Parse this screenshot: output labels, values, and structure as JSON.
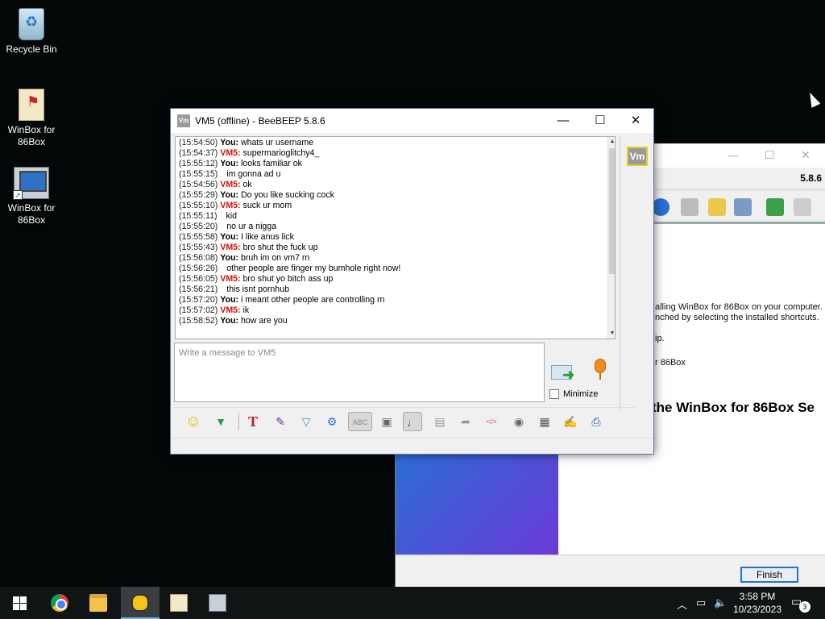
{
  "desktop": {
    "icons": [
      {
        "label": "Recycle Bin",
        "icon": "recycle-bin-icon"
      },
      {
        "label": "WinBox for 86Box",
        "icon": "winbox-document-icon"
      },
      {
        "label": "WinBox for 86Box",
        "icon": "winbox-computer-icon"
      }
    ]
  },
  "installer": {
    "version": "5.8.6",
    "heading": "the WinBox for 86Box Se",
    "line1": "alling WinBox for 86Box on your computer. T",
    "line2": "nched by selecting the installed shortcuts.",
    "line3": "ip.",
    "line4": "r 86Box",
    "finish_label": "Finish"
  },
  "chat": {
    "title": "VM5 (offline) - BeeBEEP 5.8.6",
    "app_icon_text": "Vm",
    "peer_badge": "Vm",
    "compose_placeholder": "Write a message to VM5",
    "minimize_label": "Minimize",
    "minimize_checked": false,
    "messages": [
      {
        "time": "(15:54:50)",
        "sender": "You:",
        "type": "me",
        "text": "whats ur username"
      },
      {
        "time": "(15:54:37)",
        "sender": "VM5:",
        "type": "vm",
        "text": "supermarioglitchy4_"
      },
      {
        "time": "(15:55:12)",
        "sender": "You:",
        "type": "me",
        "text": "looks familiar ok"
      },
      {
        "time": "(15:55:15)",
        "sender": "",
        "type": "cont",
        "text": "im gonna ad u"
      },
      {
        "time": "(15:54:56)",
        "sender": "VM5:",
        "type": "vm",
        "text": "ok"
      },
      {
        "time": "(15:55:29)",
        "sender": "You:",
        "type": "me",
        "text": "Do you like sucking cock"
      },
      {
        "time": "(15:55:10)",
        "sender": "VM5:",
        "type": "vm",
        "text": "suck ur mom"
      },
      {
        "time": "(15:55:11)",
        "sender": "",
        "type": "cont",
        "text": "kid"
      },
      {
        "time": "(15:55:20)",
        "sender": "",
        "type": "cont",
        "text": "no ur a nigga"
      },
      {
        "time": "(15:55:58)",
        "sender": "You:",
        "type": "me",
        "text": "I like anus lick"
      },
      {
        "time": "(15:55:43)",
        "sender": "VM5:",
        "type": "vm",
        "text": "bro shut the fuck up"
      },
      {
        "time": "(15:56:08)",
        "sender": "You:",
        "type": "me",
        "text": "bruh im on vm7 rn"
      },
      {
        "time": "(15:56:26)",
        "sender": "",
        "type": "cont",
        "text": "other people are finger my bumhole right now!"
      },
      {
        "time": "(15:56:05)",
        "sender": "VM5:",
        "type": "vm",
        "text": "bro shut yo bitch ass up"
      },
      {
        "time": "(15:56:21)",
        "sender": "",
        "type": "cont",
        "text": "this isnt pornhub"
      },
      {
        "time": "(15:57:20)",
        "sender": "You:",
        "type": "me",
        "text": "i meant other people are controlling rn"
      },
      {
        "time": "(15:57:02)",
        "sender": "VM5:",
        "type": "vm",
        "text": "ik"
      },
      {
        "time": "(15:58:52)",
        "sender": "You:",
        "type": "me",
        "text": "how are you"
      }
    ],
    "toolbar": [
      "emoticons-icon",
      "file-send-icon",
      "font-icon",
      "color-icon",
      "filter-icon",
      "settings-icon",
      "spellcheck-icon",
      "autocomplete-icon",
      "note-icon",
      "save-icon",
      "forward-icon",
      "html-icon",
      "screenshot-icon",
      "archive-icon",
      "edit-icon",
      "print-icon"
    ]
  },
  "taskbar": {
    "items": [
      "start-icon",
      "chrome-icon",
      "file-explorer-icon",
      "beebeep-icon",
      "winbox-icon",
      "86box-icon"
    ],
    "time": "3:58 PM",
    "date": "10/23/2023",
    "notification_count": "3"
  },
  "colors": {
    "desktop_bg": "#030707",
    "vm_sender": "#d01010",
    "taskbar_bg": "#101414",
    "accent": "#2a6fd6"
  }
}
